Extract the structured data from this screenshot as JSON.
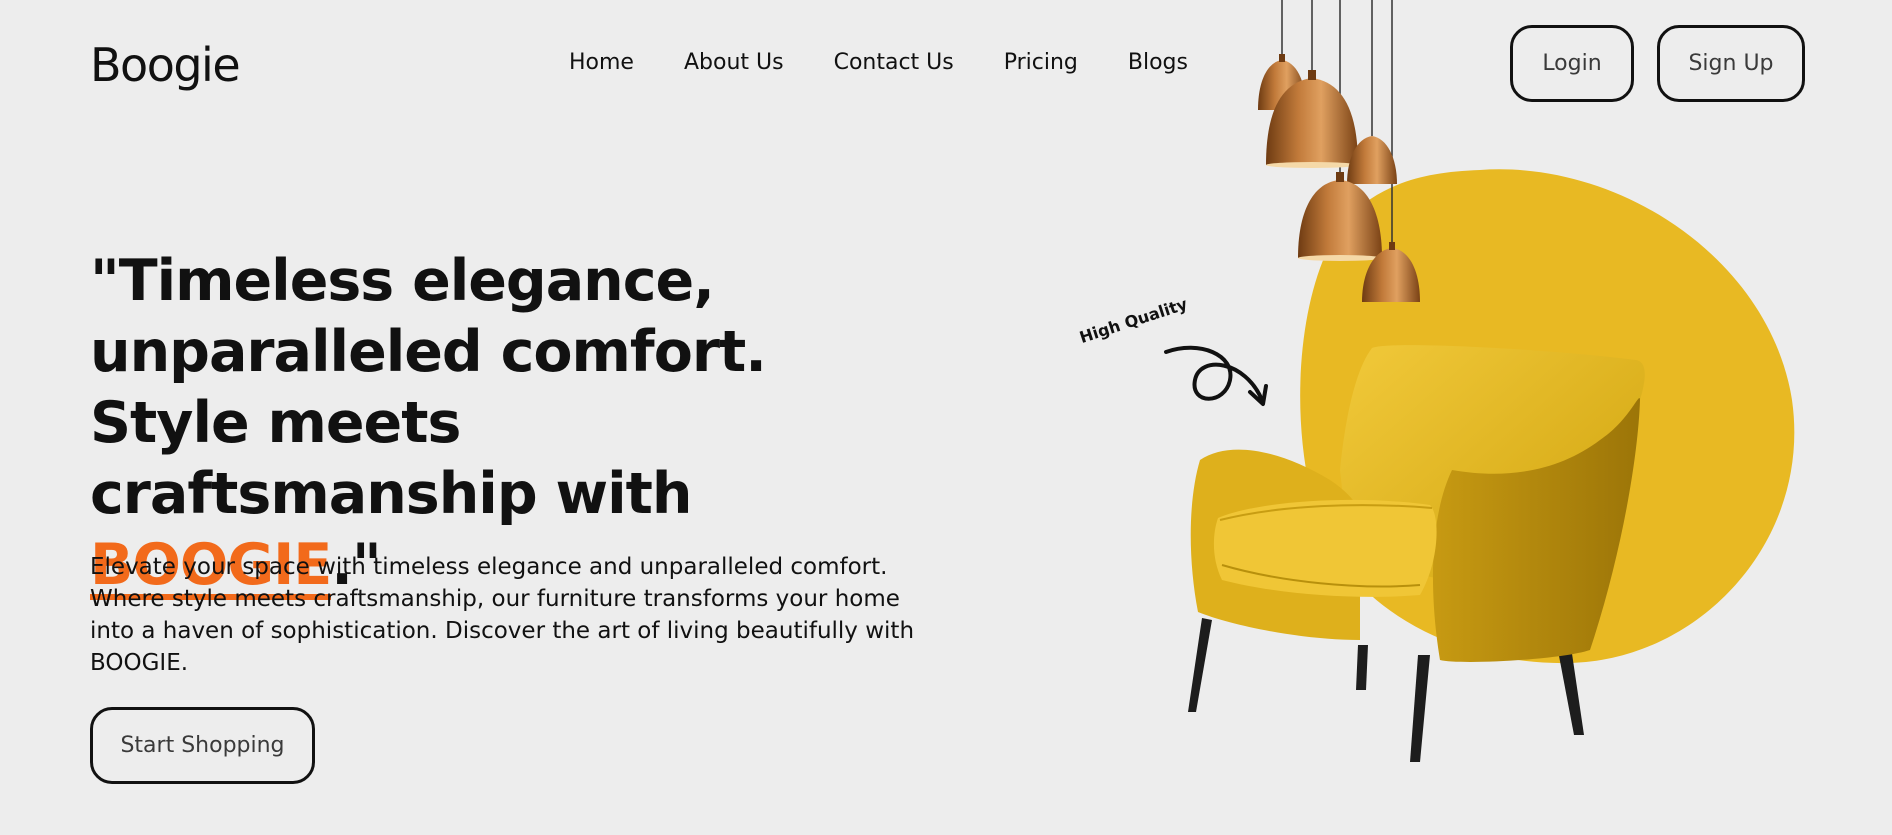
{
  "header": {
    "logo": "Boogie",
    "nav": [
      "Home",
      "About Us",
      "Contact Us",
      "Pricing",
      "Blogs"
    ],
    "login_label": "Login",
    "signup_label": "Sign Up"
  },
  "hero": {
    "headline_main": "\"Timeless elegance, unparalleled comfort. Style meets craftsmanship with ",
    "headline_brand": "BOOGIE",
    "headline_end": ".\"",
    "description": "Elevate your space with timeless elegance and unparalleled comfort. Where style meets craftsmanship, our furniture transforms your home into a haven of sophistication. Discover the art of living beautifully with BOOGIE.",
    "cta_label": "Start Shopping"
  },
  "visual": {
    "badge_text": "High Quality",
    "accent_color": "#f26a1b",
    "blob_color": "#e8b923",
    "chair_color": "#e2b51f",
    "lamp_color": "#b56a2b",
    "icons": [
      "pendant-lamps",
      "armchair",
      "curly-arrow-icon"
    ]
  }
}
